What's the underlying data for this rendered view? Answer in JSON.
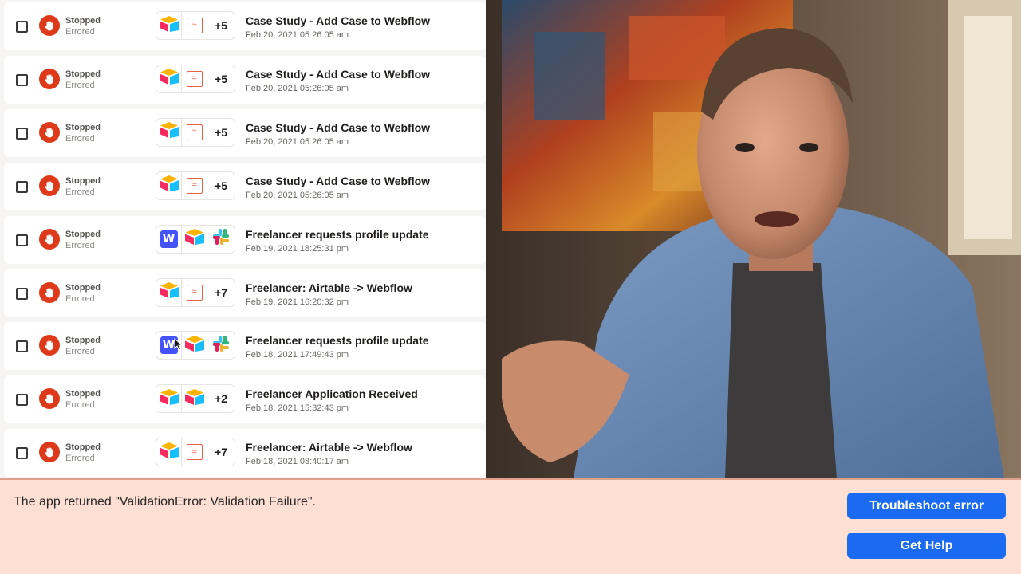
{
  "runs": [
    {
      "status": "Stopped",
      "substatus": "Errored",
      "apps": [
        "airtable-icon",
        "formatter-icon"
      ],
      "more": "+5",
      "title": "Case Study - Add Case to Webflow",
      "date": "Feb 20, 2021 05:26:05 am"
    },
    {
      "status": "Stopped",
      "substatus": "Errored",
      "apps": [
        "airtable-icon",
        "formatter-icon"
      ],
      "more": "+5",
      "title": "Case Study - Add Case to Webflow",
      "date": "Feb 20, 2021 05:26:05 am"
    },
    {
      "status": "Stopped",
      "substatus": "Errored",
      "apps": [
        "airtable-icon",
        "formatter-icon"
      ],
      "more": "+5",
      "title": "Case Study - Add Case to Webflow",
      "date": "Feb 20, 2021 05:26:05 am"
    },
    {
      "status": "Stopped",
      "substatus": "Errored",
      "apps": [
        "airtable-icon",
        "formatter-icon"
      ],
      "more": "+5",
      "title": "Case Study - Add Case to Webflow",
      "date": "Feb 20, 2021 05:26:05 am"
    },
    {
      "status": "Stopped",
      "substatus": "Errored",
      "apps": [
        "webflow-icon",
        "airtable-icon",
        "slack-icon"
      ],
      "more": "",
      "title": "Freelancer requests profile update",
      "date": "Feb 19, 2021 18:25:31 pm"
    },
    {
      "status": "Stopped",
      "substatus": "Errored",
      "apps": [
        "airtable-icon",
        "formatter-icon"
      ],
      "more": "+7",
      "title": "Freelancer: Airtable -> Webflow",
      "date": "Feb 19, 2021 16:20:32 pm"
    },
    {
      "status": "Stopped",
      "substatus": "Errored",
      "apps": [
        "webflow-icon",
        "airtable-icon",
        "slack-icon"
      ],
      "more": "",
      "title": "Freelancer requests profile update",
      "date": "Feb 18, 2021 17:49:43 pm"
    },
    {
      "status": "Stopped",
      "substatus": "Errored",
      "apps": [
        "airtable-icon",
        "airtable-icon"
      ],
      "more": "+2",
      "title": "Freelancer Application Received",
      "date": "Feb 18, 2021 15:32:43 pm"
    },
    {
      "status": "Stopped",
      "substatus": "Errored",
      "apps": [
        "airtable-icon",
        "formatter-icon"
      ],
      "more": "+7",
      "title": "Freelancer: Airtable -> Webflow",
      "date": "Feb 18, 2021 08:40:17 am"
    }
  ],
  "error_banner": {
    "message": "The app returned \"ValidationError: Validation Failure\".",
    "troubleshoot_label": "Troubleshoot error",
    "help_label": "Get Help"
  },
  "colors": {
    "stopped_red": "#de3a1a",
    "button_blue": "#1a6bf2",
    "banner_bg": "#fddfd4"
  }
}
